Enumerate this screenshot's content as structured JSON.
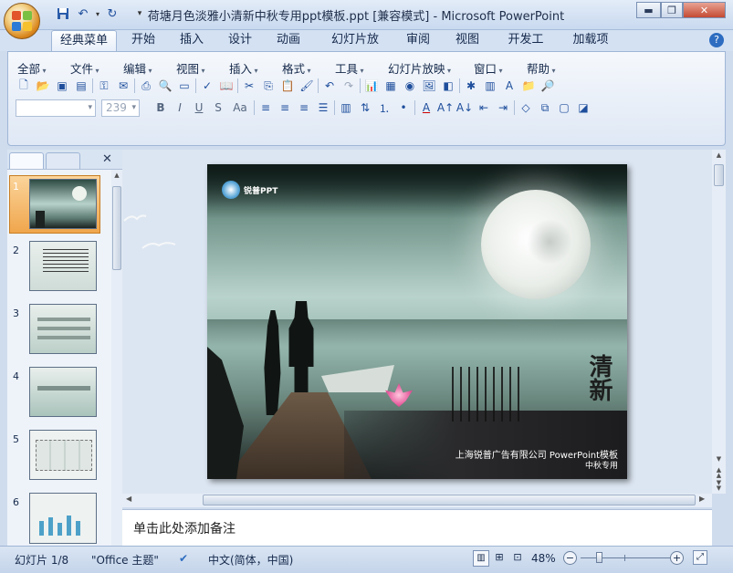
{
  "window": {
    "title": "荷塘月色淡雅小清新中秋专用ppt模板.ppt [兼容模式] - Microsoft PowerPoint"
  },
  "tabs": [
    "经典菜单",
    "开始",
    "插入",
    "设计",
    "动画",
    "幻灯片放映",
    "审阅",
    "视图",
    "开发工具",
    "加载项"
  ],
  "classic_menu": [
    "全部",
    "文件",
    "编辑",
    "视图",
    "插入",
    "格式",
    "工具",
    "幻灯片放映",
    "窗口",
    "帮助"
  ],
  "font": {
    "name_placeholder": "",
    "size": "239"
  },
  "thumbnails": [
    {
      "num": "1",
      "selected": true
    },
    {
      "num": "2"
    },
    {
      "num": "3"
    },
    {
      "num": "4"
    },
    {
      "num": "5"
    },
    {
      "num": "6"
    }
  ],
  "slide": {
    "logo": "锐普PPT",
    "calligraphy": "清新",
    "company": "上海锐普广告有限公司 PowerPoint模板",
    "subtitle": "中秋专用"
  },
  "notes_placeholder": "单击此处添加备注",
  "status": {
    "slide": "幻灯片 1/8",
    "theme": "\"Office 主题\"",
    "language": "中文(简体，中国)",
    "zoom": "48%",
    "zoom_level": 0.48
  },
  "colors": {
    "accent": "#1e4e9c",
    "selected": "#f0a64c"
  }
}
